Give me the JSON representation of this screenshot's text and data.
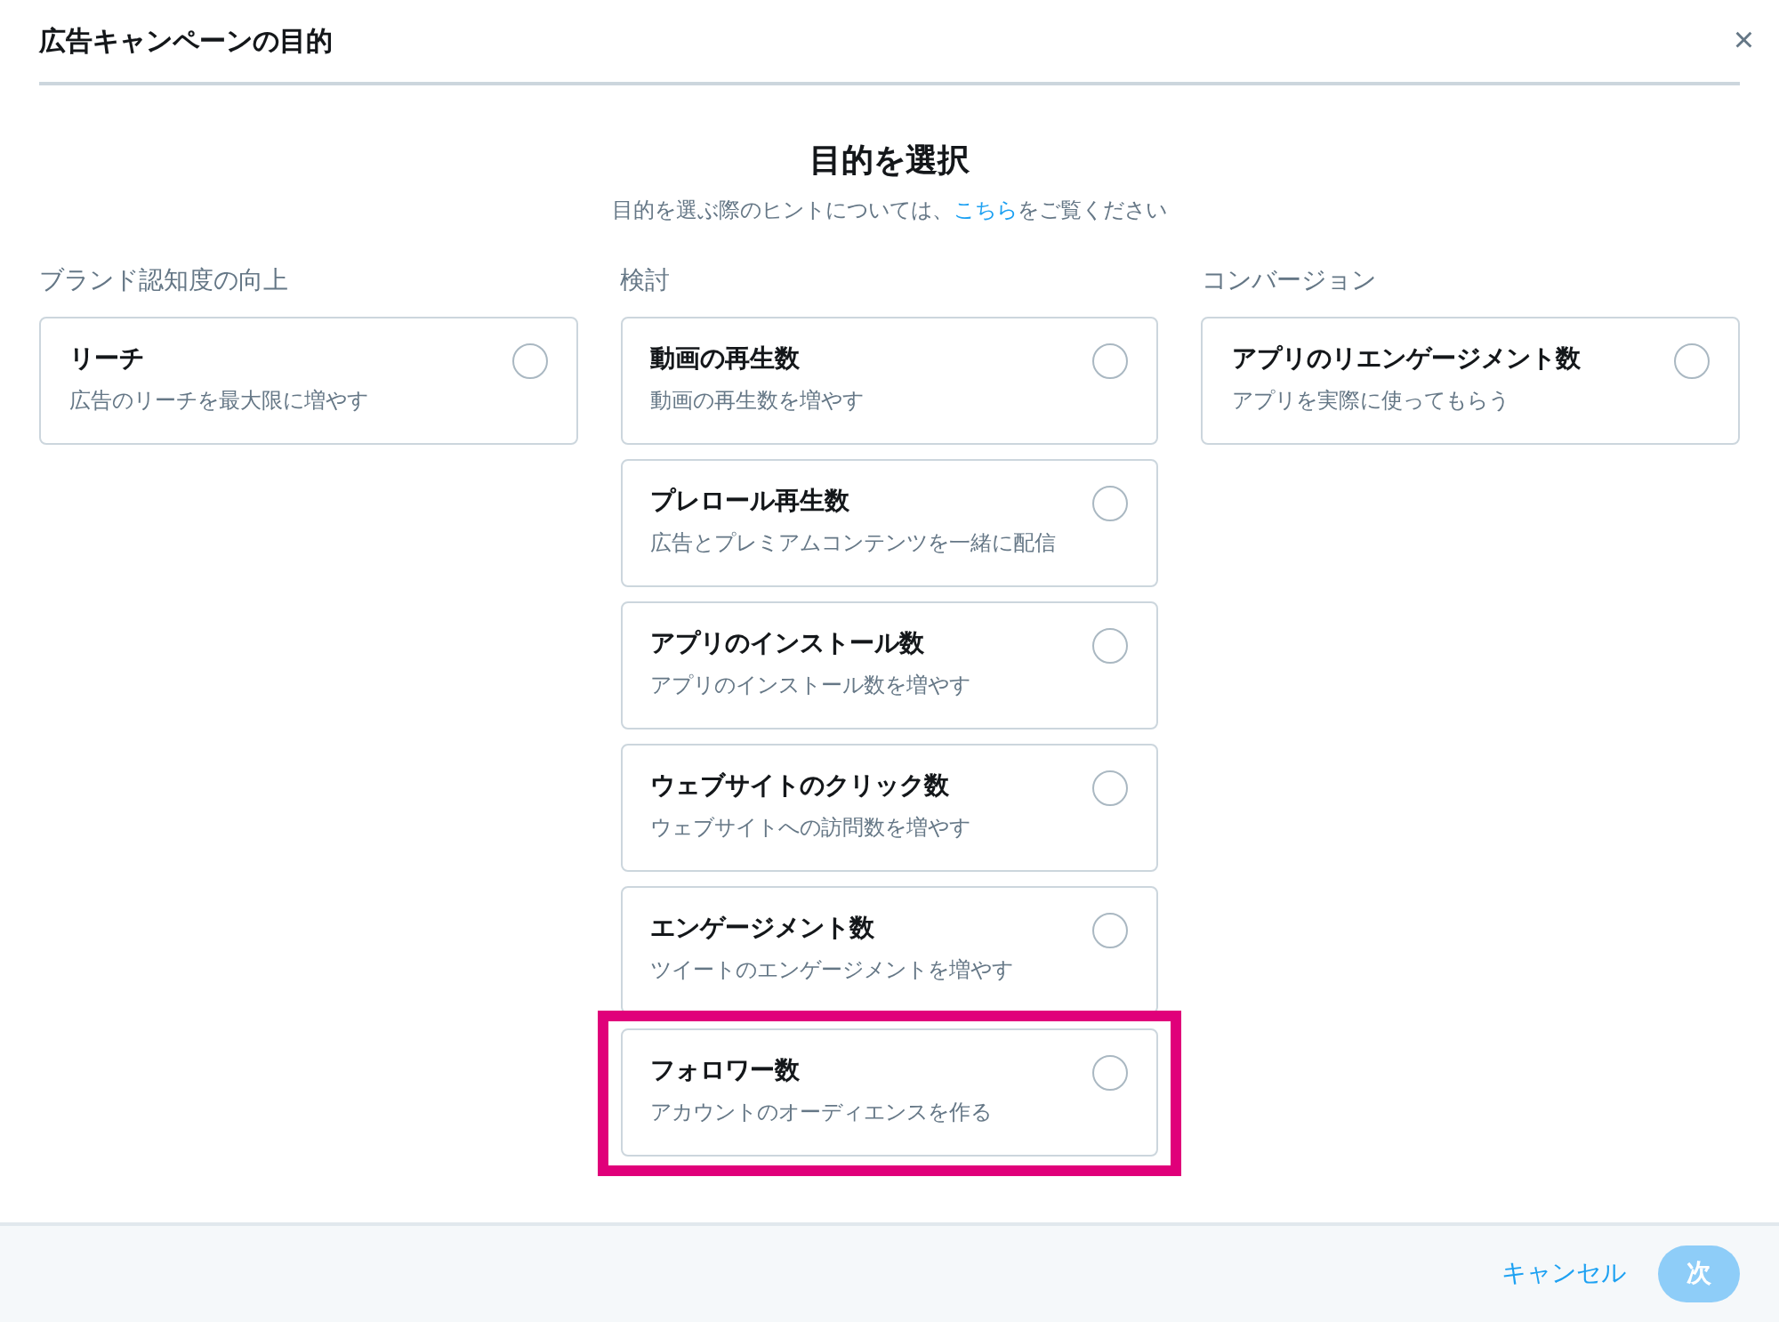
{
  "dialog": {
    "title": "広告キャンペーンの目的",
    "close": "×"
  },
  "heading": "目的を選択",
  "hint": {
    "before": "目的を選ぶ際のヒントについては、",
    "link": "こちら",
    "after": "をご覧ください"
  },
  "columns": [
    {
      "label": "ブランド認知度の向上",
      "options": [
        {
          "title": "リーチ",
          "description": "広告のリーチを最大限に増やす",
          "selected": false,
          "highlighted": false
        }
      ]
    },
    {
      "label": "検討",
      "options": [
        {
          "title": "動画の再生数",
          "description": "動画の再生数を増やす",
          "selected": false,
          "highlighted": false
        },
        {
          "title": "プレロール再生数",
          "description": "広告とプレミアムコンテンツを一緒に配信",
          "selected": false,
          "highlighted": false
        },
        {
          "title": "アプリのインストール数",
          "description": "アプリのインストール数を増やす",
          "selected": false,
          "highlighted": false
        },
        {
          "title": "ウェブサイトのクリック数",
          "description": "ウェブサイトへの訪問数を増やす",
          "selected": false,
          "highlighted": false
        },
        {
          "title": "エンゲージメント数",
          "description": "ツイートのエンゲージメントを増やす",
          "selected": false,
          "highlighted": false
        },
        {
          "title": "フォロワー数",
          "description": "アカウントのオーディエンスを作る",
          "selected": false,
          "highlighted": true
        }
      ]
    },
    {
      "label": "コンバージョン",
      "options": [
        {
          "title": "アプリのリエンゲージメント数",
          "description": "アプリを実際に使ってもらう",
          "selected": false,
          "highlighted": false
        }
      ]
    }
  ],
  "footer": {
    "cancel": "キャンセル",
    "next": {
      "label": "次",
      "disabled": true
    }
  }
}
